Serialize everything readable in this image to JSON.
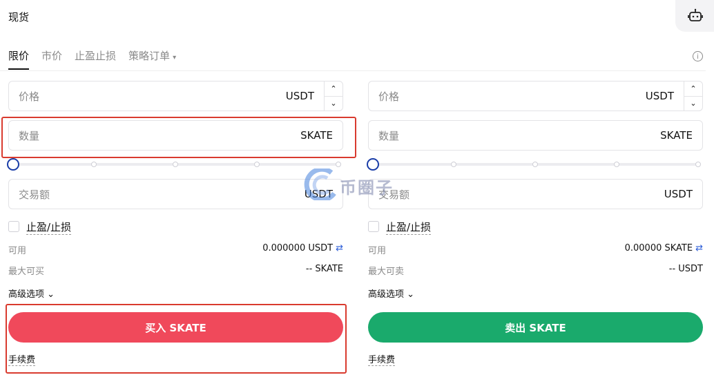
{
  "header": {
    "title": "现货"
  },
  "tabs": [
    {
      "label": "限价",
      "active": true
    },
    {
      "label": "市价"
    },
    {
      "label": "止盈止损"
    },
    {
      "label": "策略订单",
      "caret": "▾"
    }
  ],
  "info_icon_glyph": "i",
  "buy": {
    "price": {
      "placeholder": "价格",
      "unit": "USDT"
    },
    "amount": {
      "placeholder": "数量",
      "unit": "SKATE"
    },
    "total": {
      "placeholder": "交易额",
      "unit": "USDT"
    },
    "tpsl_label": "止盈/止损",
    "available_label": "可用",
    "available_value": "0.000000 USDT",
    "max_label": "最大可买",
    "max_value": "-- SKATE",
    "advanced_label": "高级选项",
    "button_label": "买入 SKATE",
    "fee_label": "手续费",
    "slider_percent": 0
  },
  "sell": {
    "price": {
      "placeholder": "价格",
      "unit": "USDT"
    },
    "amount": {
      "placeholder": "数量",
      "unit": "SKATE"
    },
    "total": {
      "placeholder": "交易额",
      "unit": "USDT"
    },
    "tpsl_label": "止盈/止损",
    "available_label": "可用",
    "available_value": "0.00000 SKATE",
    "max_label": "最大可卖",
    "max_value": "-- USDT",
    "advanced_label": "高级选项",
    "button_label": "卖出 SKATE",
    "fee_label": "手续费",
    "slider_percent": 0
  },
  "glyphs": {
    "up": "⌃",
    "down": "⌄",
    "chevron": "⌄",
    "swap": "⇄"
  },
  "watermark": "币圈子",
  "colors": {
    "buy": "#f0495b",
    "sell": "#1aaa6c",
    "highlight": "#d93a2e",
    "slider_knob": "#1a3da8"
  },
  "icons": [
    "robot-icon",
    "info-icon",
    "swap-icon",
    "chevron-down-icon",
    "caret-down-icon"
  ]
}
